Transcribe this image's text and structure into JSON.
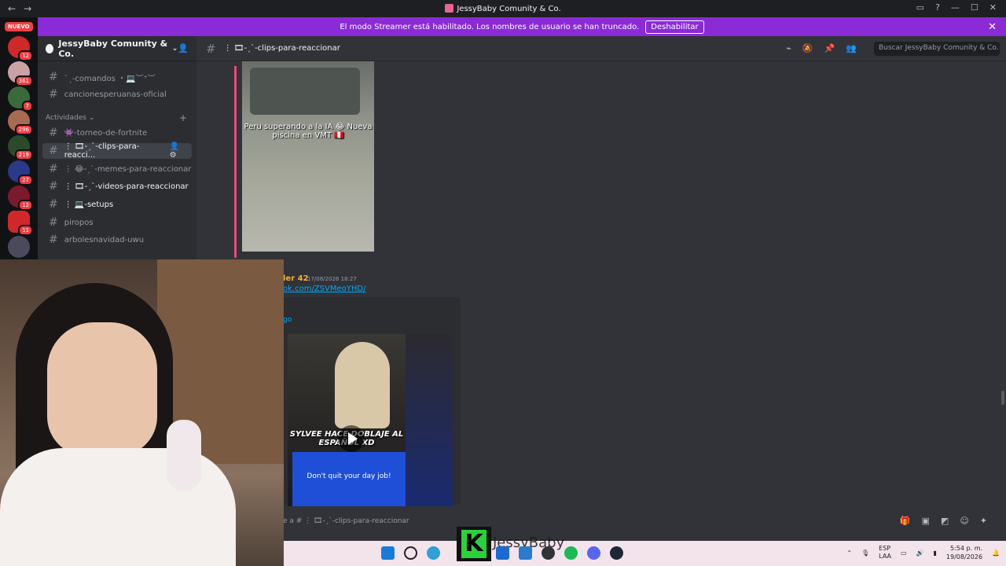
{
  "window": {
    "title": "JessyBaby Comunity & Co."
  },
  "banner": {
    "text": "El modo Streamer está habilitado. Los nombres de usuario se han truncado.",
    "button_label": "Deshabilitar"
  },
  "servers": {
    "new_label": "NUEVO",
    "badges": [
      "12",
      "361",
      "7",
      "296",
      "219",
      "27",
      "12",
      "11"
    ]
  },
  "guild": {
    "name": "JessyBaby Comunity & Co."
  },
  "sidebar": {
    "channels_top": [
      {
        "label": "ˋˏ-comandos ・💻︶⁺︶",
        "tail": ""
      },
      {
        "label": "cancionesperuanas-oficial",
        "tail": ""
      }
    ],
    "category": "Actividades",
    "channels": [
      {
        "label": "👾-torneo-de-fortnite"
      },
      {
        "label": "⋮ 🎞-ˏˋ-clips-para-reacci...",
        "active": true
      },
      {
        "label": "⋮ 😂-ˏˋ-memes-para-reaccionar"
      },
      {
        "label": "⋮ 🎞-ˏˋ-videos-para-reaccionar",
        "bold": true
      },
      {
        "label": "⋮ 💻-setups",
        "bold": true
      },
      {
        "label": "piropos"
      },
      {
        "label": "arbolesnavidad-uwu"
      }
    ]
  },
  "chat": {
    "channel_name": "⋮ 🎞-ˏˋ-clips-para-reaccionar",
    "search_placeholder": "Buscar JessyBaby Comunity & Co.",
    "clip1_caption": "Peru superando a la IA 😂 Nueva piscina en VMT 🇵🇪",
    "message_author": "ler 42",
    "message_time": "17/08/2026 18:27",
    "message_link": "ok.com/ZSVMeoYHD/",
    "embed_title": "go",
    "clip2_caption": "SYLVEE HACE DOBLAJE AL ESPAÑOL XD",
    "clip2_panel_text": "Don't quit your day job!",
    "composer_placeholder": "e a # ⋮ 🎞-ˏˋ-clips-para-reaccionar"
  },
  "taskbar": {
    "overlay_letter": "K",
    "overlay_name": "JessyBaby",
    "lang_line1": "ESP",
    "lang_line2": "LAA",
    "time": "5:54 p. m.",
    "date": "19/08/2026"
  }
}
